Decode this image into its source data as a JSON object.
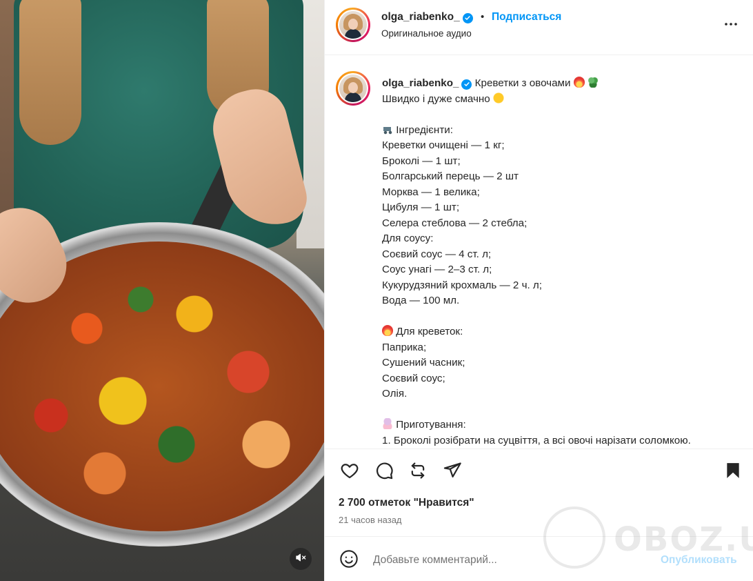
{
  "post": {
    "username": "olga_riabenko_",
    "dot": "•",
    "follow_label": "Подписаться",
    "audio_label": "Оригинальное аудио"
  },
  "caption": {
    "line1": "Креветки з овочами",
    "line2": "Швидко і дуже смачно",
    "ingredients_heading": "Інгредієнти:",
    "ingredients": [
      "Креветки очищені — 1 кг;",
      "Броколі — 1 шт;",
      "Болгарський перець — 2 шт",
      "Морква — 1 велика;",
      "Цибуля — 1 шт;",
      "Селера стеблова — 2 стебла;",
      "Для соусу:",
      "Соєвий соус — 4 ст. л;",
      "Соус унагі — 2–3 ст. л;",
      "Кукурудзяний крохмаль — 2 ч. л;",
      "Вода — 100 мл."
    ],
    "shrimp_heading": "Для креветок:",
    "shrimp": [
      "Паприка;",
      "Сушений часник;",
      "Соєвий соус;",
      "Олія."
    ],
    "cooking_heading": "Приготування:",
    "step1": "1. Броколі розібрати на суцвіття, а всі овочі нарізати соломкою."
  },
  "stats": {
    "likes": "2 700 отметок \"Нравится\"",
    "time": "21 часов назад"
  },
  "comment": {
    "placeholder": "Добавьте комментарий...",
    "publish_label": "Опубликовать"
  },
  "watermark": {
    "text": "OBOZ.UA"
  },
  "colors": {
    "accent": "#0095f6",
    "publish_disabled": "#b2dffc",
    "secondary_text": "#737373",
    "border": "#efefef"
  },
  "icons": {
    "verified": "verified-badge-icon",
    "more": "more-options-icon",
    "like": "heart-icon",
    "comment": "comment-icon",
    "repost": "repost-icon",
    "share": "share-icon",
    "save": "bookmark-icon",
    "emoji": "emoji-icon",
    "mute": "muted-speaker-icon"
  }
}
